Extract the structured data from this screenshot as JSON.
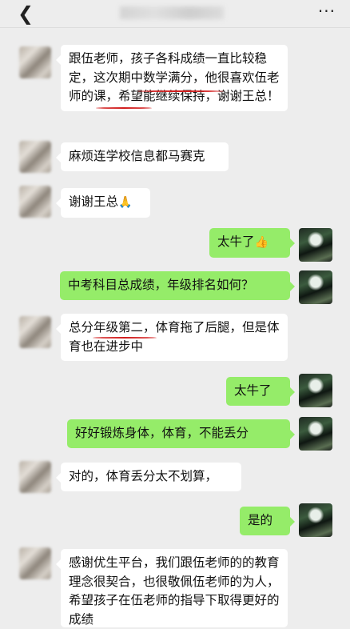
{
  "header": {
    "back_icon": "chevron-left-icon",
    "more_icon": "more-dots-icon",
    "title": "",
    "title_note_blurred": true
  },
  "messages": [
    {
      "side": "left",
      "text": "跟伍老师，孩子各科成绩一直比较稳定，这次期中数学满分，他很喜欢伍老师的课，希望能继续保持，谢谢王总！"
    },
    {
      "side": "left",
      "text": "麻烦连学校信息都马赛克"
    },
    {
      "side": "left",
      "text": "谢谢王总",
      "emoji": "🙏"
    },
    {
      "side": "right",
      "text": "太牛了",
      "emoji": "👍"
    },
    {
      "side": "right",
      "text": "中考科目总成绩，年级排名如何？"
    },
    {
      "side": "left",
      "text": "总分年级第二，体育拖了后腿，但是体育也在进步中"
    },
    {
      "side": "right",
      "text": "太牛了"
    },
    {
      "side": "right",
      "text": "好好锻炼身体，体育，不能丢分"
    },
    {
      "side": "left",
      "text": "对的，体育丢分太不划算，"
    },
    {
      "side": "right",
      "text": "是的"
    },
    {
      "side": "left",
      "text": "感谢优生平台，我们跟伍老师的的教育理念很契合，也很敬佩伍老师的为人，希望孩子在伍老师的指导下取得更好的成绩"
    }
  ],
  "colors": {
    "background": "#ededed",
    "left_bubble": "#ffffff",
    "right_bubble": "#95ec69",
    "annotation_red": "#d21e1e"
  }
}
